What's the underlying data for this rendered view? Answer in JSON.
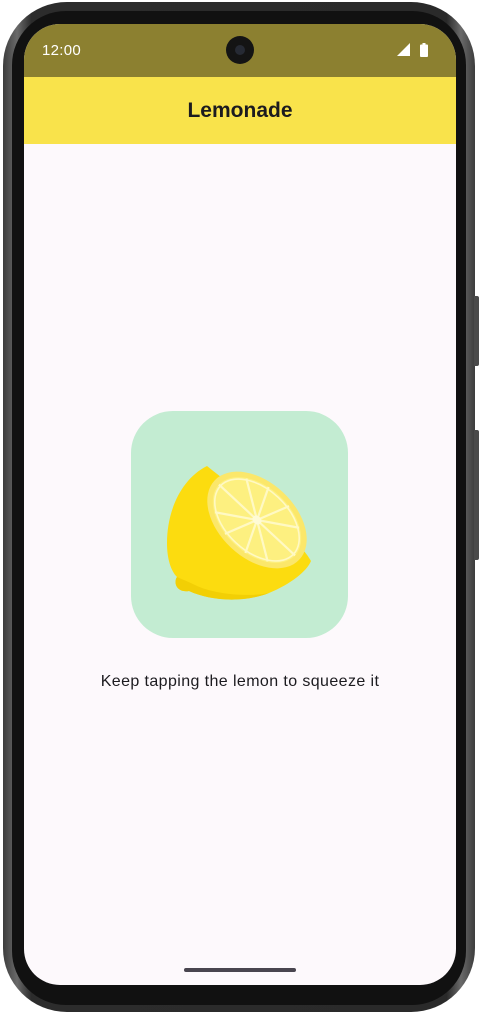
{
  "status_bar": {
    "time": "12:00",
    "icons": [
      "signal-icon",
      "battery-icon"
    ],
    "background": "#8c8030"
  },
  "app_bar": {
    "title": "Lemonade",
    "background": "#f9e34b"
  },
  "main": {
    "image": {
      "icon": "lemon-tree-icon",
      "description": "lemon half",
      "background": "#c3ecd2"
    },
    "instruction": "Keep tapping the lemon to squeeze it"
  },
  "colors": {
    "screen_background": "#fdf9fc",
    "text": "#1c1b1f"
  }
}
